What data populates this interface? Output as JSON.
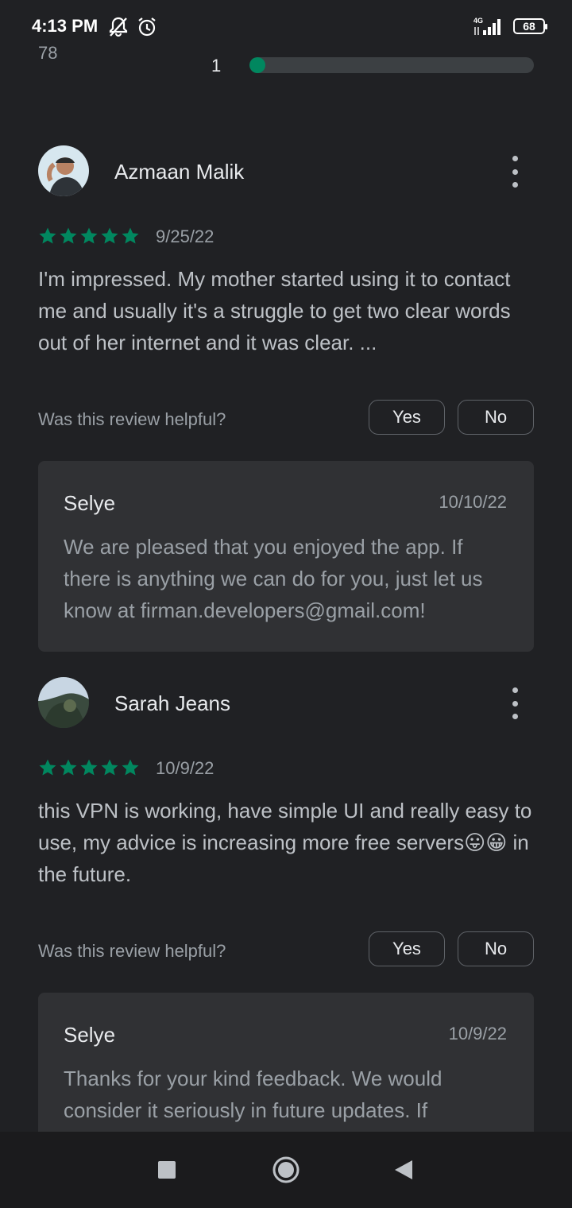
{
  "status_bar": {
    "time": "4:13 PM",
    "icons_left": [
      "bell-off-icon",
      "alarm-icon"
    ],
    "network": "4G",
    "battery": "68"
  },
  "rating_breakdown": {
    "partial_label": "78",
    "row_label": "1",
    "row_fill_fraction": 0.05,
    "accent": "#01875f"
  },
  "reviews": [
    {
      "name": "Azmaan Malik",
      "stars": 5,
      "date": "9/25/22",
      "text": "I'm impressed. My mother started using it to contact me and usually it's a struggle to get two clear words out of her internet and it was clear. ...",
      "helpful_question": "Was this review helpful?",
      "yes_label": "Yes",
      "no_label": "No",
      "reply": {
        "developer": "Selye",
        "date": "10/10/22",
        "text": "We are pleased that you enjoyed the app. If there is anything we can do for you, just let us know at firman.developers@gmail.com!"
      }
    },
    {
      "name": "Sarah Jeans",
      "stars": 5,
      "date": "10/9/22",
      "text": "this VPN is working, have simple UI and really easy to use, my advice is increasing more free servers😛😀 in the future.",
      "helpful_question": "Was this review helpful?",
      "yes_label": "Yes",
      "no_label": "No",
      "reply": {
        "developer": "Selye",
        "date": "10/9/22",
        "text": "Thanks for your kind feedback. We would consider it seriously in future updates. If"
      }
    }
  ],
  "nav_bar": {
    "buttons": [
      "recents-icon",
      "home-icon",
      "back-icon"
    ]
  }
}
